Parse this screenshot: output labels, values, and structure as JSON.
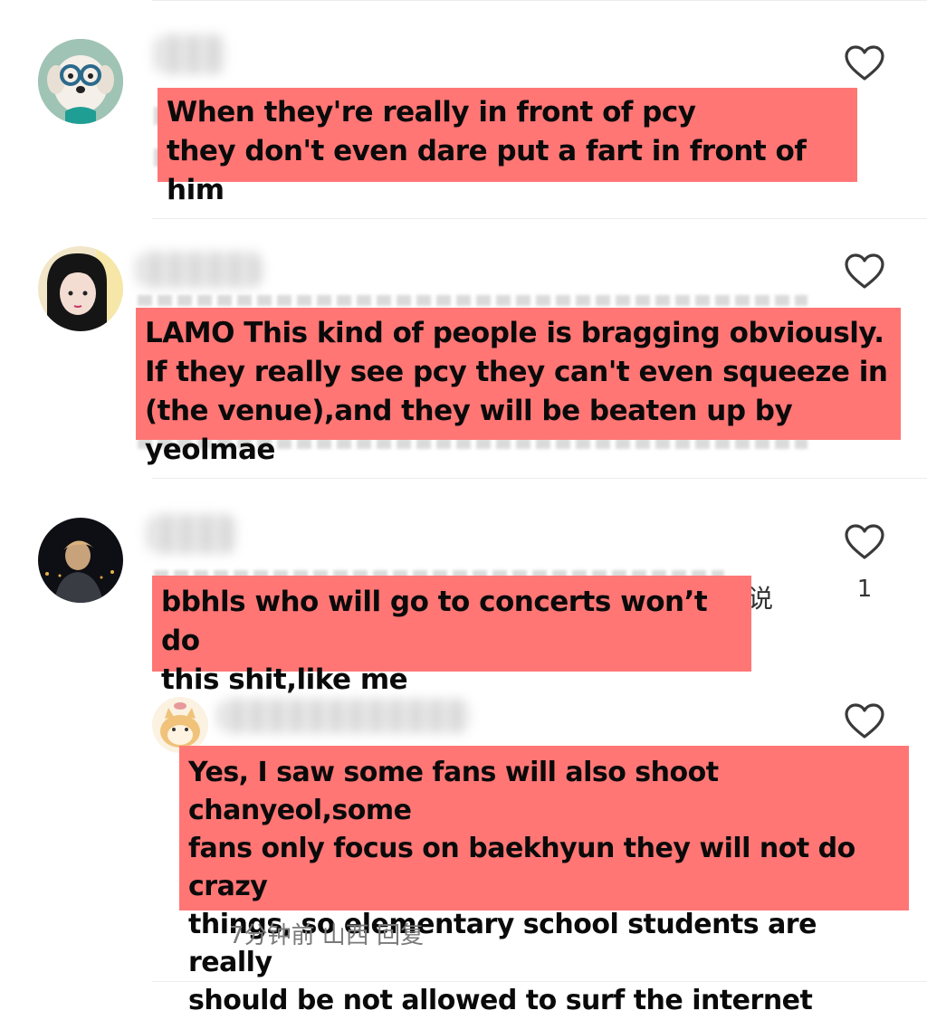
{
  "comments": [
    {
      "caption": "When they're really in front of pcy\nthey don't even dare put a fart in front of him",
      "like_count": ""
    },
    {
      "caption": "LAMO This kind of people is bragging obviously.\nIf they really see pcy they can't even squeeze in\n (the venue),and they will be beaten up by yeolmae",
      "like_count": ""
    },
    {
      "caption": "bbhls who will go to concerts won’t do\nthis shit,like me",
      "like_count": "1",
      "edge_char": "说",
      "reply": {
        "caption": "Yes, I saw some fans will also shoot chanyeol,some\nfans only focus on baekhyun they will not do crazy\nthings, so elementary school students are  really\nshould be not allowed to surf the internet",
        "meta": "7分钟前  山西  回复"
      }
    }
  ],
  "colors": {
    "caption_bg": "#ff7675",
    "icon_stroke": "#3a3a3a",
    "divider": "#ececec"
  },
  "icons": [
    "heart-outline-icon"
  ]
}
